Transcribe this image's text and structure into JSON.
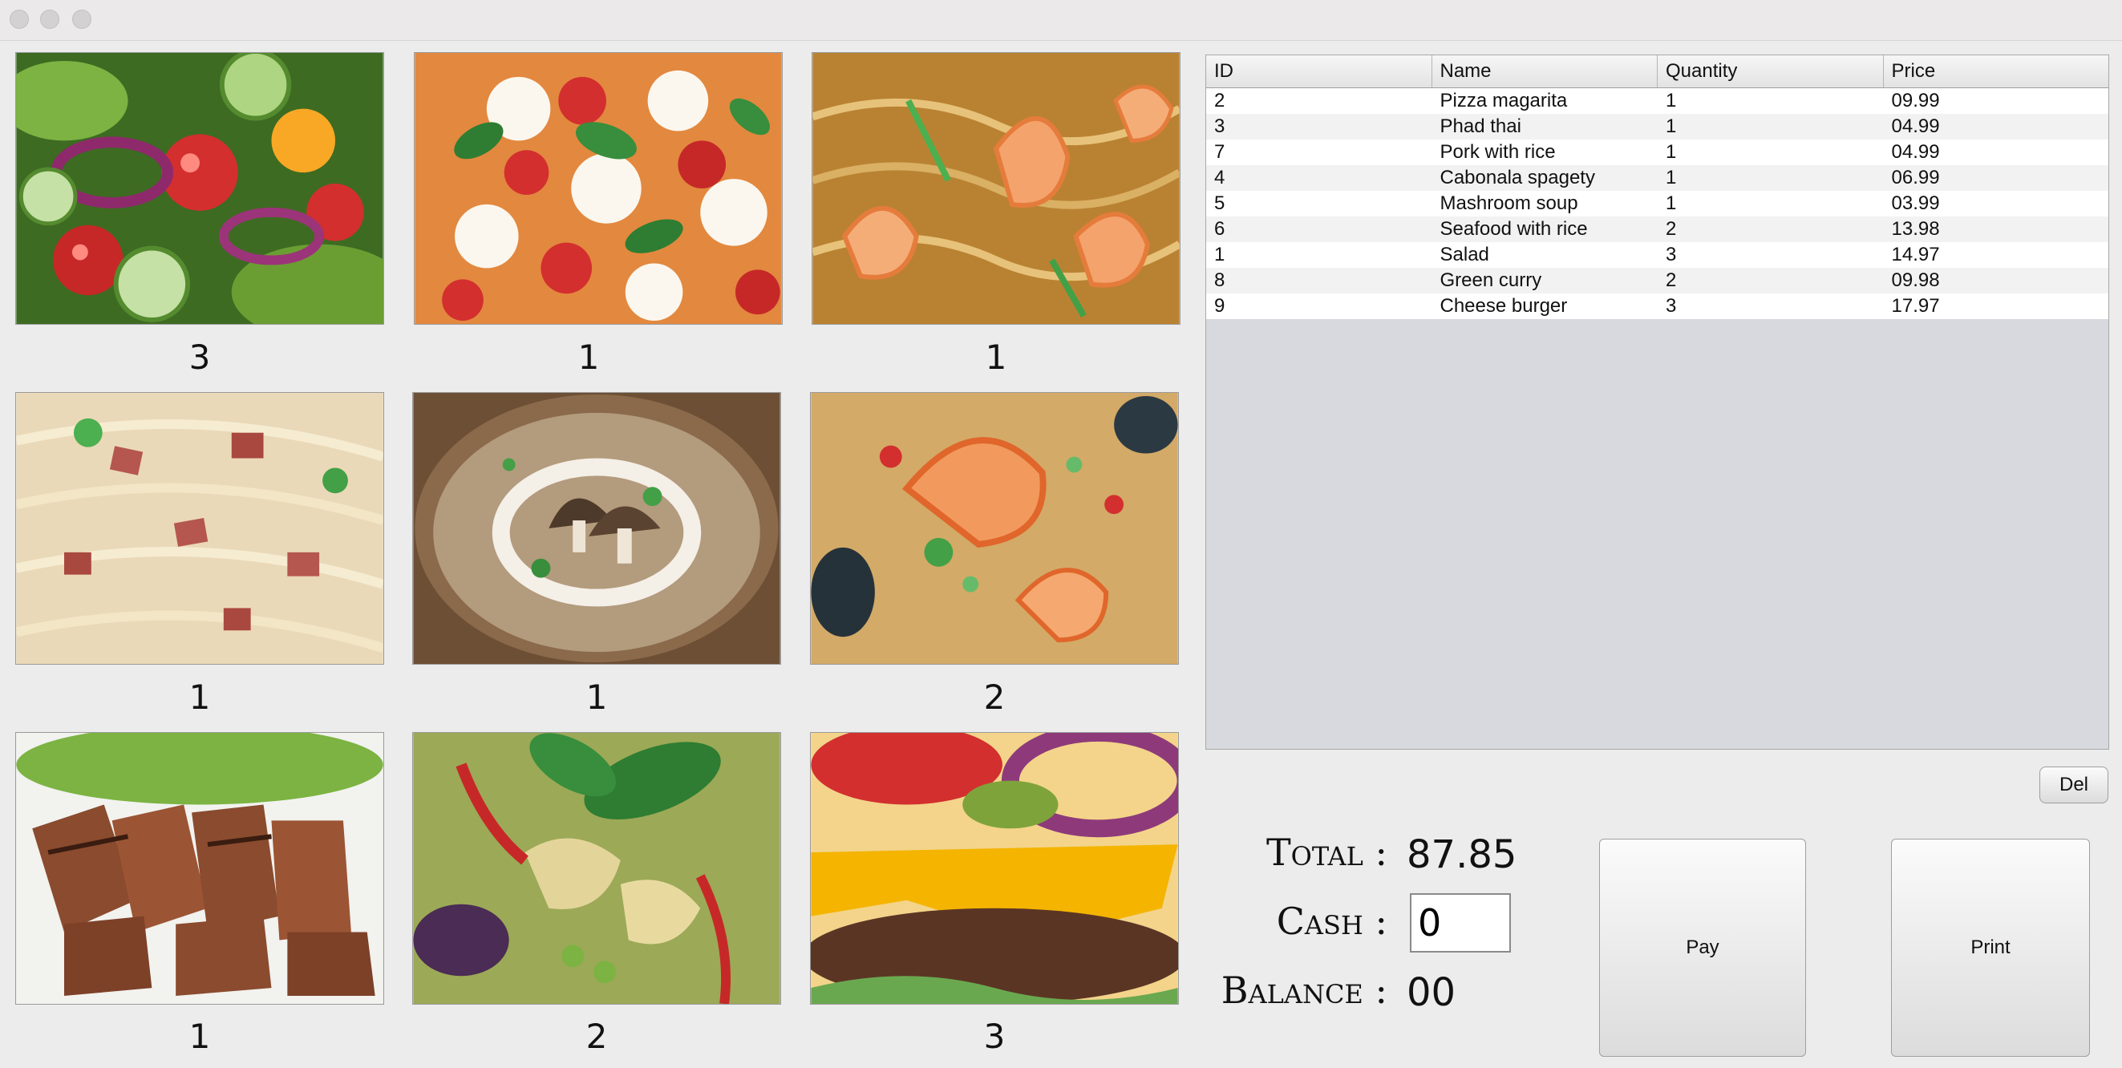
{
  "window": {
    "title": ""
  },
  "menu_items": [
    {
      "name": "Salad",
      "count": "3"
    },
    {
      "name": "Pizza magarita",
      "count": "1"
    },
    {
      "name": "Phad thai",
      "count": "1"
    },
    {
      "name": "Cabonala spagety",
      "count": "1"
    },
    {
      "name": "Mashroom soup",
      "count": "1"
    },
    {
      "name": "Seafood with rice",
      "count": "2"
    },
    {
      "name": "Pork with rice",
      "count": "1"
    },
    {
      "name": "Green curry",
      "count": "2"
    },
    {
      "name": "Cheese burger",
      "count": "3"
    }
  ],
  "order_table": {
    "columns": [
      "ID",
      "Name",
      "Quantity",
      "Price"
    ],
    "rows": [
      [
        "2",
        "Pizza magarita",
        "1",
        "09.99"
      ],
      [
        "3",
        "Phad thai",
        "1",
        "04.99"
      ],
      [
        "7",
        "Pork with rice",
        "1",
        "04.99"
      ],
      [
        "4",
        "Cabonala spagety",
        "1",
        "06.99"
      ],
      [
        "5",
        "Mashroom soup",
        "1",
        "03.99"
      ],
      [
        "6",
        "Seafood with rice",
        "2",
        "13.98"
      ],
      [
        "1",
        "Salad",
        "3",
        "14.97"
      ],
      [
        "8",
        "Green curry",
        "2",
        "09.98"
      ],
      [
        "9",
        "Cheese burger",
        "3",
        "17.97"
      ]
    ]
  },
  "buttons": {
    "del": "Del",
    "pay": "Pay",
    "print": "Print"
  },
  "summary": {
    "total_label": "Total :",
    "total_value": "87.85",
    "cash_label": "Cash :",
    "cash_value": "0",
    "balance_label": "Balance :",
    "balance_value": "00"
  },
  "colors": {
    "table_bg": "#d8d9de",
    "window_bg": "#ececec"
  }
}
